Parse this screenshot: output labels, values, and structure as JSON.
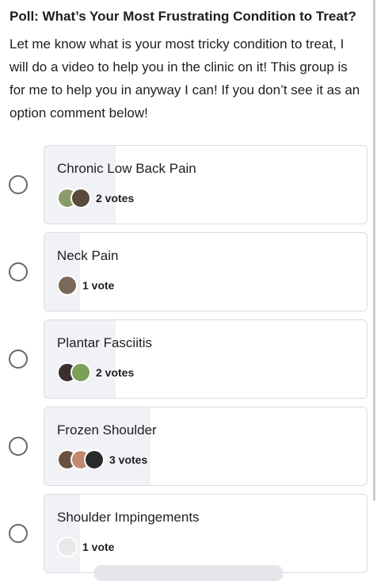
{
  "post": {
    "title": "Poll: What’s Your Most Frustrating Condition to Treat?",
    "body": "Let me know what is your most tricky condition to treat, I will do a video to help you in the clinic on it! This group is for me to help you in anyway I can! If you don’t see it as an option comment below!"
  },
  "poll": {
    "options": [
      {
        "label": "Chronic Low Back Pain",
        "votes_text": "2 votes",
        "share": 0.22,
        "avatars": [
          "#8a9a6a",
          "#5a4a3a"
        ]
      },
      {
        "label": "Neck Pain",
        "votes_text": "1 vote",
        "share": 0.11,
        "avatars": [
          "#7a6858"
        ]
      },
      {
        "label": "Plantar Fasciitis",
        "votes_text": "2 votes",
        "share": 0.22,
        "avatars": [
          "#3a3030",
          "#7aa05a"
        ]
      },
      {
        "label": "Frozen Shoulder",
        "votes_text": "3 votes",
        "share": 0.33,
        "avatars": [
          "#6a5040",
          "#c08a70",
          "#2a2a2a"
        ]
      },
      {
        "label": "Shoulder Impingements",
        "votes_text": "1 vote",
        "share": 0.11,
        "avatars": [
          "#e8e8e8"
        ]
      }
    ]
  }
}
